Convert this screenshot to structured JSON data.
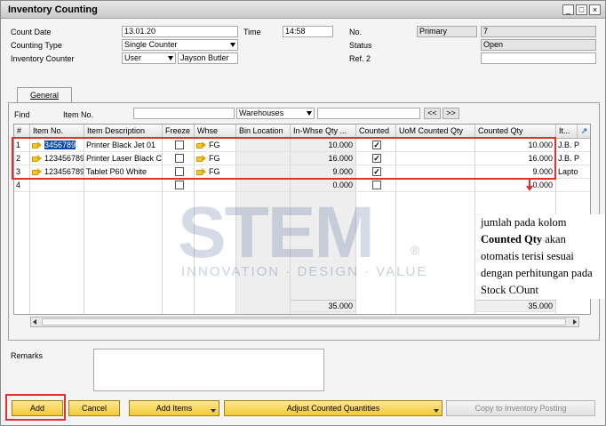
{
  "window": {
    "title": "Inventory Counting",
    "buttons": [
      "_",
      "□",
      "×"
    ]
  },
  "header": {
    "count_date_label": "Count Date",
    "count_date": "13.01.20",
    "time_label": "Time",
    "time": "14:58",
    "no_label": "No.",
    "series": "Primary",
    "number": "7",
    "counting_type_label": "Counting Type",
    "counting_type": "Single Counter",
    "status_label": "Status",
    "status": "Open",
    "inventory_counter_label": "Inventory Counter",
    "counter_type": "User",
    "counter_name": "Jayson Butler",
    "ref2_label": "Ref. 2",
    "ref2": ""
  },
  "tabs": [
    {
      "label": "General"
    }
  ],
  "find": {
    "label": "Find",
    "item_no_label": "Item No.",
    "item_no": "",
    "warehouses": "Warehouses",
    "warehouse_value": "",
    "prev": "<<",
    "next": ">>"
  },
  "grid": {
    "columns": [
      "#",
      "Item No.",
      "Item Description",
      "Freeze",
      "Whse",
      "Bin Location",
      "In-Whse Qty ...",
      "Counted",
      "UoM Counted Qty",
      "Counted Qty",
      "It..."
    ],
    "rows": [
      {
        "n": "1",
        "item": "3456789",
        "desc": "Printer Black Jet 01",
        "freeze": "",
        "whse": "FG",
        "bin": "",
        "inwhse": "10.000",
        "counted": "✓",
        "uom": "",
        "cqty": "10.000",
        "it": "J.B. P"
      },
      {
        "n": "2",
        "item": "123456789",
        "desc": "Printer Laser Black C",
        "freeze": "",
        "whse": "FG",
        "bin": "",
        "inwhse": "16.000",
        "counted": "✓",
        "uom": "",
        "cqty": "16.000",
        "it": "J.B. P"
      },
      {
        "n": "3",
        "item": "123456789",
        "desc": "Tablet P60 White",
        "freeze": "",
        "whse": "FG",
        "bin": "",
        "inwhse": "9.000",
        "counted": "✓",
        "uom": "",
        "cqty": "9.000",
        "it": "Lapto"
      },
      {
        "n": "4",
        "item": "",
        "desc": "",
        "freeze": "",
        "whse": "",
        "bin": "",
        "inwhse": "0.000",
        "counted": "",
        "uom": "",
        "cqty": "0.000",
        "it": ""
      }
    ],
    "totals": {
      "inwhse": "35.000",
      "cqty": "35.000"
    }
  },
  "remarks": {
    "label": "Remarks",
    "value": ""
  },
  "buttons": {
    "add": "Add",
    "cancel": "Cancel",
    "add_items": "Add Items",
    "adjust": "Adjust Counted Quantities",
    "copy": "Copy to Inventory Posting"
  },
  "watermark": {
    "main": "STEM",
    "sub": "INNOVATION · DESIGN · VALUE",
    "reg": "®"
  },
  "note": {
    "part1": "jumlah pada kolom",
    "bold": "Counted Qty",
    "part2": "akan otomatis terisi sesuai dengan perhitungan pada Stock COunt"
  },
  "colors": {
    "accent": "#f2c93a",
    "highlight": "#e03030",
    "selection": "#0b4aa8"
  }
}
